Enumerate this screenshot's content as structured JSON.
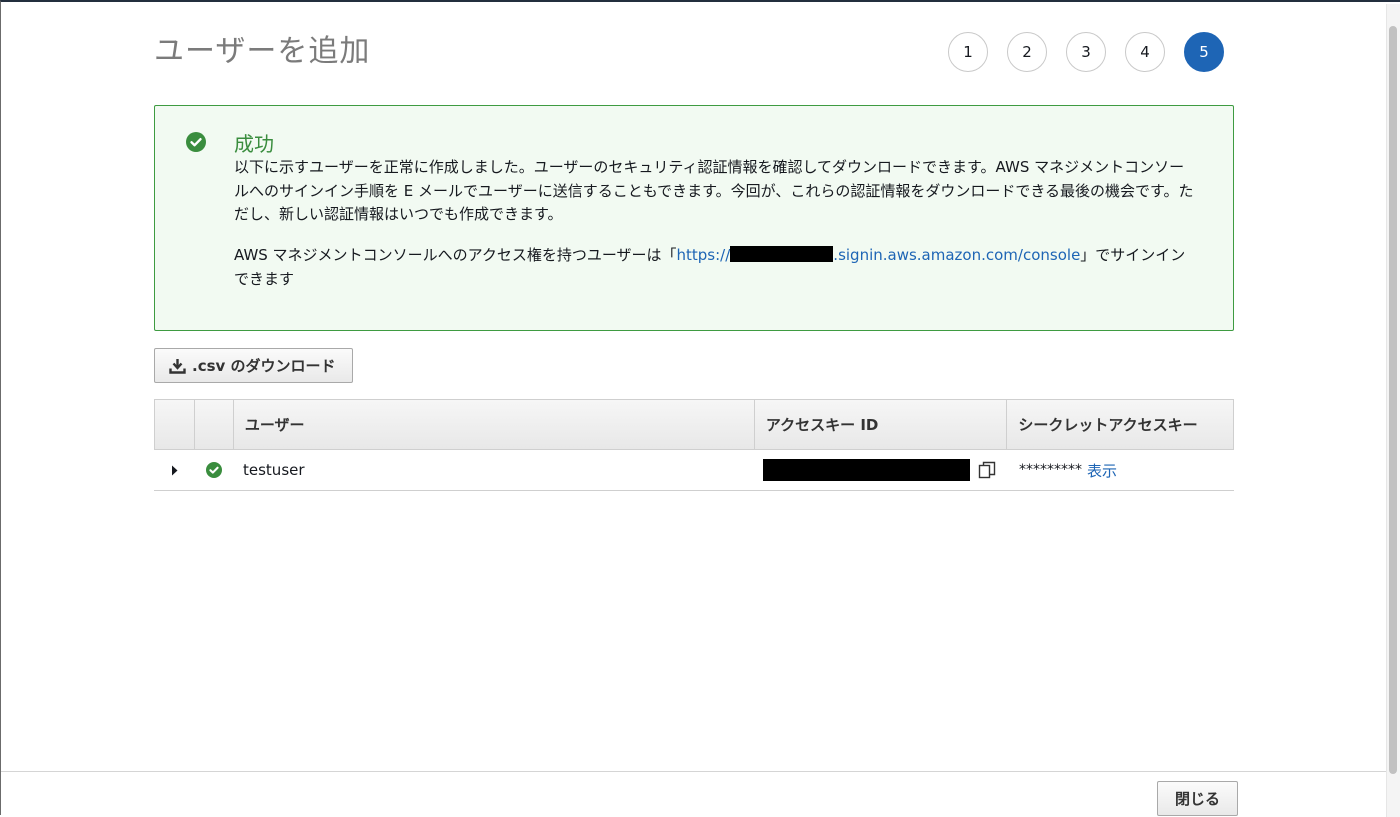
{
  "page": {
    "title": "ユーザーを追加"
  },
  "steps": [
    "1",
    "2",
    "3",
    "4",
    "5"
  ],
  "active_step": "5",
  "success": {
    "title": "成功",
    "message": "以下に示すユーザーを正常に作成しました。ユーザーのセキュリティ認証情報を確認してダウンロードできます。AWS マネジメントコンソールへのサインイン手順を E メールでユーザーに送信することもできます。今回が、これらの認証情報をダウンロードできる最後の機会です。ただし、新しい認証情報はいつでも作成できます。",
    "access_prefix": "AWS マネジメントコンソールへのアクセス権を持つユーザーは「",
    "url_start": "https://",
    "url_end": ".signin.aws.amazon.com/console",
    "access_suffix": "」でサインインできます"
  },
  "toolbar": {
    "download_csv_label": ".csv のダウンロード"
  },
  "table": {
    "headers": {
      "user": "ユーザー",
      "access_key_id": "アクセスキー ID",
      "secret_access_key": "シークレットアクセスキー"
    },
    "rows": [
      {
        "user": "testuser",
        "secret_masked": "*********",
        "show_label": "表示"
      }
    ]
  },
  "footer": {
    "close_label": "閉じる"
  },
  "colors": {
    "accent": "#1e65b5",
    "success": "#3a8d3e",
    "success_bg": "#f2faf2"
  }
}
